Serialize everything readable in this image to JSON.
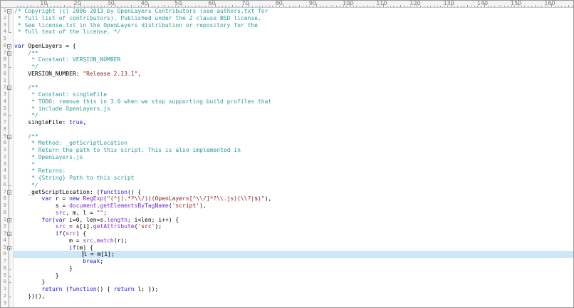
{
  "ruler": {
    "labels": [
      "10",
      "20",
      "30",
      "40",
      "50",
      "60",
      "70",
      "80",
      "90",
      "100",
      "110",
      "120",
      "130",
      "140",
      "150",
      "160",
      "170",
      "180"
    ]
  },
  "gutter": {
    "line_numbers": [
      "1",
      "2",
      "3",
      "4",
      "5",
      "6",
      "7",
      "8",
      "9",
      "0",
      "1",
      "2",
      "3",
      "4",
      "5",
      "6",
      "7",
      "8",
      "9",
      "0",
      "1",
      "2",
      "3",
      "4",
      "5",
      "6",
      "7",
      "8",
      "9",
      "0",
      "1",
      "2",
      "3",
      "4",
      "5",
      "6",
      "7",
      "8",
      "9",
      "0",
      "1",
      "2",
      "3"
    ]
  },
  "editor": {
    "current_line_index": 35,
    "lines": [
      [
        {
          "t": "cm",
          "v": "/* Copyright (c) 2006-2013 by OpenLayers Contributors (see authors.txt for"
        }
      ],
      [
        {
          "t": "cm",
          "v": " * full list of contributors). Published under the 2-clause BSD license."
        }
      ],
      [
        {
          "t": "cm",
          "v": " * See license.txt in the OpenLayers distribution or repository for the"
        }
      ],
      [
        {
          "t": "cm",
          "v": " * full text of the license. */"
        }
      ],
      [],
      [
        {
          "t": "kw",
          "v": "var"
        },
        {
          "t": "op",
          "v": " OpenLayers = {"
        }
      ],
      [
        {
          "t": "cm",
          "v": "    /**"
        }
      ],
      [
        {
          "t": "cm",
          "v": "     * Constant: VERSION_NUMBER"
        }
      ],
      [
        {
          "t": "cm",
          "v": "     */"
        }
      ],
      [
        {
          "t": "op",
          "v": "    VERSION_NUMBER: "
        },
        {
          "t": "str",
          "v": "\"Release 2.13.1\""
        },
        {
          "t": "op",
          "v": ","
        }
      ],
      [],
      [
        {
          "t": "cm",
          "v": "    /**"
        }
      ],
      [
        {
          "t": "cm",
          "v": "     * Constant: singleFile"
        }
      ],
      [
        {
          "t": "cm",
          "v": "     * TODO: remove this in 3.0 when we stop supporting build profiles that"
        }
      ],
      [
        {
          "t": "cm",
          "v": "     * include OpenLayers.js"
        }
      ],
      [
        {
          "t": "cm",
          "v": "     */"
        }
      ],
      [
        {
          "t": "op",
          "v": "    singleFile: "
        },
        {
          "t": "kw",
          "v": "true"
        },
        {
          "t": "op",
          "v": ","
        }
      ],
      [],
      [
        {
          "t": "cm",
          "v": "    /**"
        }
      ],
      [
        {
          "t": "cm",
          "v": "     * Method: _getScriptLocation"
        }
      ],
      [
        {
          "t": "cm",
          "v": "     * Return the path to this script. This is also implemented in"
        }
      ],
      [
        {
          "t": "cm",
          "v": "     * OpenLayers.js"
        }
      ],
      [
        {
          "t": "cm",
          "v": "     *"
        }
      ],
      [
        {
          "t": "cm",
          "v": "     * Returns:"
        }
      ],
      [
        {
          "t": "cm",
          "v": "     * {String} Path to this script"
        }
      ],
      [
        {
          "t": "cm",
          "v": "     */"
        }
      ],
      [
        {
          "t": "op",
          "v": "    _getScriptLocation: ("
        },
        {
          "t": "kw",
          "v": "function"
        },
        {
          "t": "op",
          "v": "() {"
        }
      ],
      [
        {
          "t": "op",
          "v": "        "
        },
        {
          "t": "kw",
          "v": "var"
        },
        {
          "t": "op",
          "v": " r = "
        },
        {
          "t": "kw",
          "v": "new"
        },
        {
          "t": "op",
          "v": " "
        },
        {
          "t": "fn",
          "v": "RegExp"
        },
        {
          "t": "op",
          "v": "("
        },
        {
          "t": "str",
          "v": "\"(^|(.*?\\\\/))(OpenLayers[^\\\\/]*?\\\\.js)(\\\\?|$)\""
        },
        {
          "t": "op",
          "v": "),"
        }
      ],
      [
        {
          "t": "op",
          "v": "            s = "
        },
        {
          "t": "fn",
          "v": "document"
        },
        {
          "t": "op",
          "v": "."
        },
        {
          "t": "fn",
          "v": "getElementsByTagName"
        },
        {
          "t": "op",
          "v": "("
        },
        {
          "t": "str",
          "v": "'script'"
        },
        {
          "t": "op",
          "v": "),"
        }
      ],
      [
        {
          "t": "op",
          "v": "            "
        },
        {
          "t": "fn",
          "v": "src"
        },
        {
          "t": "op",
          "v": ", m, l = "
        },
        {
          "t": "str",
          "v": "\"\""
        },
        {
          "t": "op",
          "v": ";"
        }
      ],
      [
        {
          "t": "op",
          "v": "        "
        },
        {
          "t": "kw",
          "v": "for"
        },
        {
          "t": "op",
          "v": "("
        },
        {
          "t": "kw",
          "v": "var"
        },
        {
          "t": "op",
          "v": " i=0, len=s."
        },
        {
          "t": "fn",
          "v": "length"
        },
        {
          "t": "op",
          "v": "; i<len; i++) {"
        }
      ],
      [
        {
          "t": "op",
          "v": "            "
        },
        {
          "t": "fn",
          "v": "src"
        },
        {
          "t": "op",
          "v": " = s[i]."
        },
        {
          "t": "fn",
          "v": "getAttribute"
        },
        {
          "t": "op",
          "v": "("
        },
        {
          "t": "str",
          "v": "'src'"
        },
        {
          "t": "op",
          "v": ");"
        }
      ],
      [
        {
          "t": "op",
          "v": "            "
        },
        {
          "t": "kw",
          "v": "if"
        },
        {
          "t": "op",
          "v": "("
        },
        {
          "t": "fn",
          "v": "src"
        },
        {
          "t": "op",
          "v": ") {"
        }
      ],
      [
        {
          "t": "op",
          "v": "                m = "
        },
        {
          "t": "fn",
          "v": "src"
        },
        {
          "t": "op",
          "v": "."
        },
        {
          "t": "fn",
          "v": "match"
        },
        {
          "t": "op",
          "v": "(r);"
        }
      ],
      [
        {
          "t": "op",
          "v": "                "
        },
        {
          "t": "kw",
          "v": "if"
        },
        {
          "t": "op",
          "v": "(m) {"
        }
      ],
      [
        {
          "t": "op",
          "v": "                    "
        },
        {
          "t": "cursor",
          "v": ""
        },
        {
          "t": "op",
          "v": "l = m[1];"
        }
      ],
      [
        {
          "t": "op",
          "v": "                    "
        },
        {
          "t": "kw",
          "v": "break"
        },
        {
          "t": "op",
          "v": ";"
        }
      ],
      [
        {
          "t": "op",
          "v": "                }"
        }
      ],
      [
        {
          "t": "op",
          "v": "            }"
        }
      ],
      [
        {
          "t": "op",
          "v": "        }"
        }
      ],
      [
        {
          "t": "op",
          "v": "        "
        },
        {
          "t": "kw",
          "v": "return"
        },
        {
          "t": "op",
          "v": " ("
        },
        {
          "t": "kw",
          "v": "function"
        },
        {
          "t": "op",
          "v": "() { "
        },
        {
          "t": "kw",
          "v": "return"
        },
        {
          "t": "op",
          "v": " l; });"
        }
      ],
      [
        {
          "t": "op",
          "v": "    })(),"
        }
      ],
      [],
      [
        {
          "t": "cm",
          "v": "    /**"
        }
      ]
    ]
  }
}
